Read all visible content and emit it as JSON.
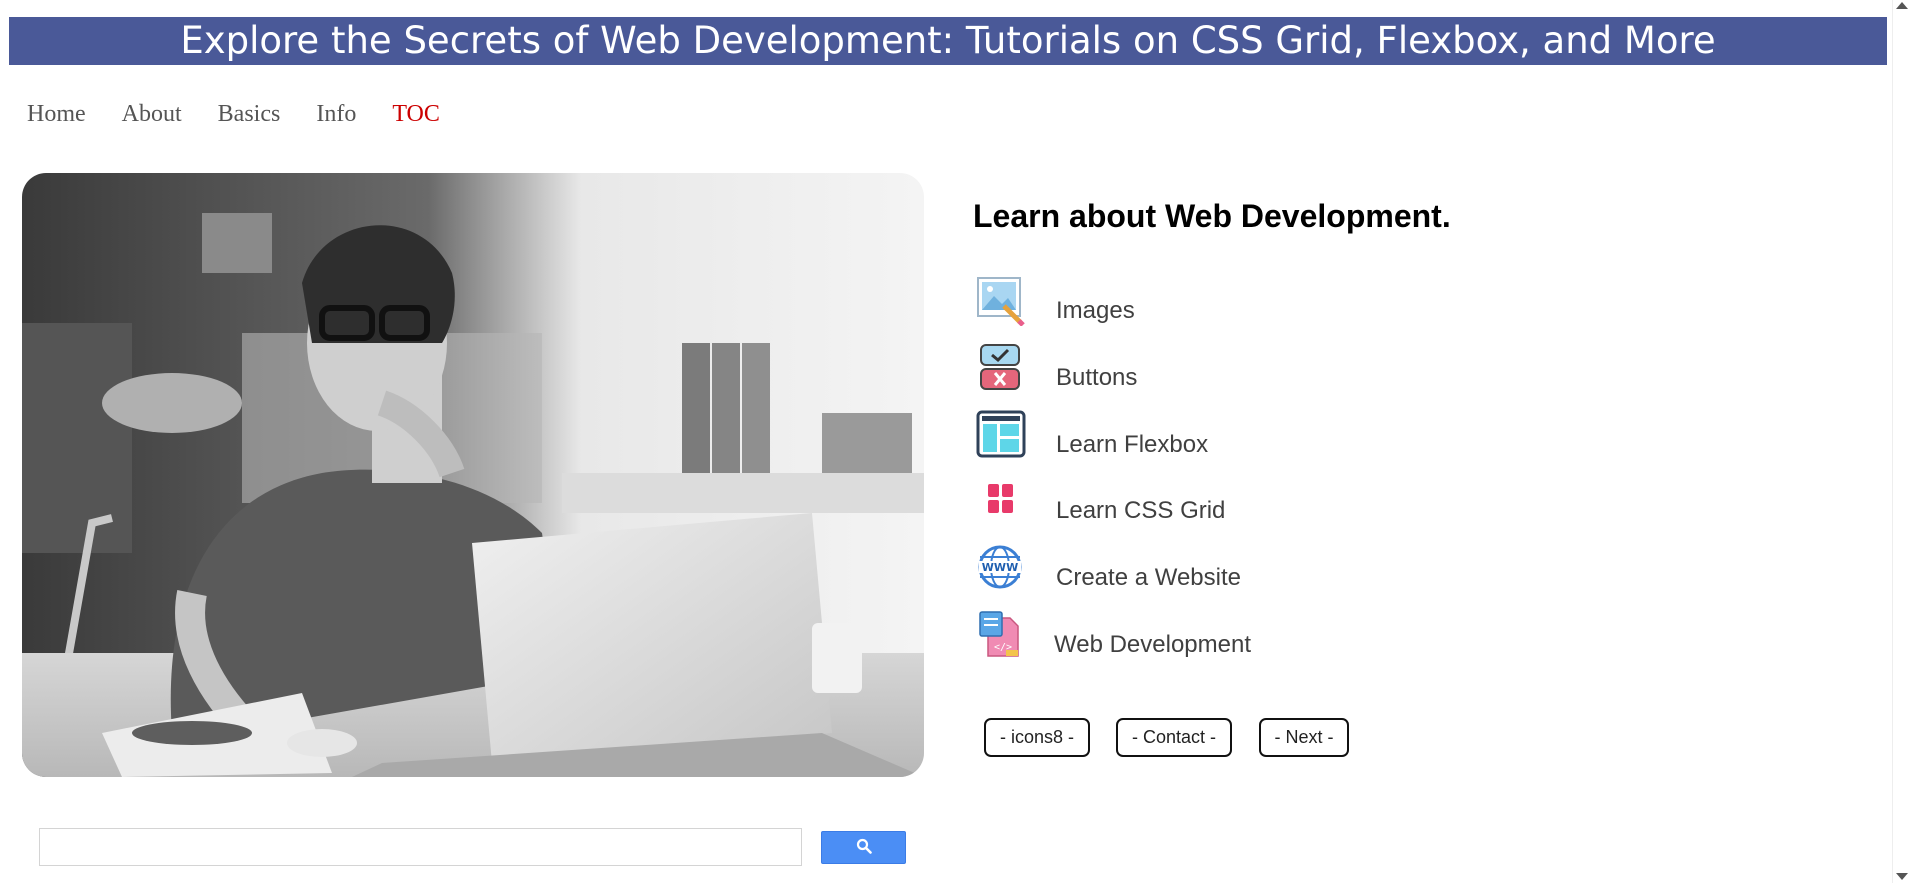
{
  "banner": {
    "title": "Explore the Secrets of Web Development: Tutorials on CSS Grid, Flexbox, and More"
  },
  "nav": {
    "items": [
      {
        "label": "Home",
        "active": false
      },
      {
        "label": "About",
        "active": false
      },
      {
        "label": "Basics",
        "active": false
      },
      {
        "label": "Info",
        "active": false
      },
      {
        "label": "TOC",
        "active": true
      }
    ],
    "active_color": "#cc0000"
  },
  "hero": {
    "image": "woman-working-at-laptop-photo",
    "style": "grayscale"
  },
  "main": {
    "heading": "Learn about Web Development.",
    "links": [
      {
        "label": "Images",
        "icon": "image-edit-icon"
      },
      {
        "label": "Buttons",
        "icon": "buttons-icon"
      },
      {
        "label": "Learn Flexbox",
        "icon": "flexbox-layout-icon"
      },
      {
        "label": "Learn CSS Grid",
        "icon": "grid-icon"
      },
      {
        "label": "Create a Website",
        "icon": "globe-www-icon"
      },
      {
        "label": "Web Development",
        "icon": "web-dev-file-icon"
      }
    ],
    "buttons": {
      "icons8": "- icons8 -",
      "contact": "- Contact -",
      "next": "- Next -"
    }
  },
  "search": {
    "value": "",
    "icon": "search-icon"
  },
  "colors": {
    "banner_bg": "#4a5998",
    "search_button": "#4b8ef5"
  }
}
